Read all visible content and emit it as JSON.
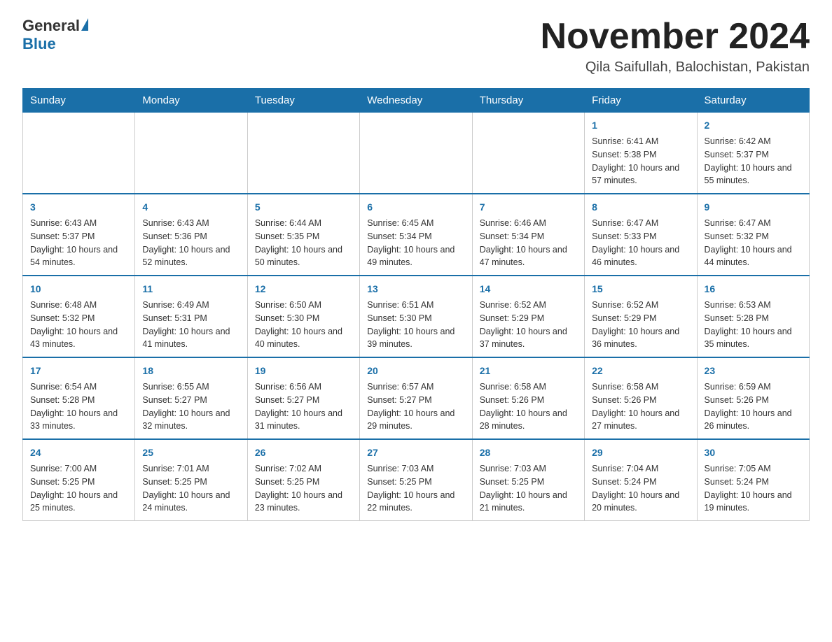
{
  "header": {
    "logo_general": "General",
    "logo_blue": "Blue",
    "month_title": "November 2024",
    "location": "Qila Saifullah, Balochistan, Pakistan"
  },
  "days_of_week": [
    "Sunday",
    "Monday",
    "Tuesday",
    "Wednesday",
    "Thursday",
    "Friday",
    "Saturday"
  ],
  "weeks": [
    [
      {
        "day": "",
        "info": ""
      },
      {
        "day": "",
        "info": ""
      },
      {
        "day": "",
        "info": ""
      },
      {
        "day": "",
        "info": ""
      },
      {
        "day": "",
        "info": ""
      },
      {
        "day": "1",
        "info": "Sunrise: 6:41 AM\nSunset: 5:38 PM\nDaylight: 10 hours and 57 minutes."
      },
      {
        "day": "2",
        "info": "Sunrise: 6:42 AM\nSunset: 5:37 PM\nDaylight: 10 hours and 55 minutes."
      }
    ],
    [
      {
        "day": "3",
        "info": "Sunrise: 6:43 AM\nSunset: 5:37 PM\nDaylight: 10 hours and 54 minutes."
      },
      {
        "day": "4",
        "info": "Sunrise: 6:43 AM\nSunset: 5:36 PM\nDaylight: 10 hours and 52 minutes."
      },
      {
        "day": "5",
        "info": "Sunrise: 6:44 AM\nSunset: 5:35 PM\nDaylight: 10 hours and 50 minutes."
      },
      {
        "day": "6",
        "info": "Sunrise: 6:45 AM\nSunset: 5:34 PM\nDaylight: 10 hours and 49 minutes."
      },
      {
        "day": "7",
        "info": "Sunrise: 6:46 AM\nSunset: 5:34 PM\nDaylight: 10 hours and 47 minutes."
      },
      {
        "day": "8",
        "info": "Sunrise: 6:47 AM\nSunset: 5:33 PM\nDaylight: 10 hours and 46 minutes."
      },
      {
        "day": "9",
        "info": "Sunrise: 6:47 AM\nSunset: 5:32 PM\nDaylight: 10 hours and 44 minutes."
      }
    ],
    [
      {
        "day": "10",
        "info": "Sunrise: 6:48 AM\nSunset: 5:32 PM\nDaylight: 10 hours and 43 minutes."
      },
      {
        "day": "11",
        "info": "Sunrise: 6:49 AM\nSunset: 5:31 PM\nDaylight: 10 hours and 41 minutes."
      },
      {
        "day": "12",
        "info": "Sunrise: 6:50 AM\nSunset: 5:30 PM\nDaylight: 10 hours and 40 minutes."
      },
      {
        "day": "13",
        "info": "Sunrise: 6:51 AM\nSunset: 5:30 PM\nDaylight: 10 hours and 39 minutes."
      },
      {
        "day": "14",
        "info": "Sunrise: 6:52 AM\nSunset: 5:29 PM\nDaylight: 10 hours and 37 minutes."
      },
      {
        "day": "15",
        "info": "Sunrise: 6:52 AM\nSunset: 5:29 PM\nDaylight: 10 hours and 36 minutes."
      },
      {
        "day": "16",
        "info": "Sunrise: 6:53 AM\nSunset: 5:28 PM\nDaylight: 10 hours and 35 minutes."
      }
    ],
    [
      {
        "day": "17",
        "info": "Sunrise: 6:54 AM\nSunset: 5:28 PM\nDaylight: 10 hours and 33 minutes."
      },
      {
        "day": "18",
        "info": "Sunrise: 6:55 AM\nSunset: 5:27 PM\nDaylight: 10 hours and 32 minutes."
      },
      {
        "day": "19",
        "info": "Sunrise: 6:56 AM\nSunset: 5:27 PM\nDaylight: 10 hours and 31 minutes."
      },
      {
        "day": "20",
        "info": "Sunrise: 6:57 AM\nSunset: 5:27 PM\nDaylight: 10 hours and 29 minutes."
      },
      {
        "day": "21",
        "info": "Sunrise: 6:58 AM\nSunset: 5:26 PM\nDaylight: 10 hours and 28 minutes."
      },
      {
        "day": "22",
        "info": "Sunrise: 6:58 AM\nSunset: 5:26 PM\nDaylight: 10 hours and 27 minutes."
      },
      {
        "day": "23",
        "info": "Sunrise: 6:59 AM\nSunset: 5:26 PM\nDaylight: 10 hours and 26 minutes."
      }
    ],
    [
      {
        "day": "24",
        "info": "Sunrise: 7:00 AM\nSunset: 5:25 PM\nDaylight: 10 hours and 25 minutes."
      },
      {
        "day": "25",
        "info": "Sunrise: 7:01 AM\nSunset: 5:25 PM\nDaylight: 10 hours and 24 minutes."
      },
      {
        "day": "26",
        "info": "Sunrise: 7:02 AM\nSunset: 5:25 PM\nDaylight: 10 hours and 23 minutes."
      },
      {
        "day": "27",
        "info": "Sunrise: 7:03 AM\nSunset: 5:25 PM\nDaylight: 10 hours and 22 minutes."
      },
      {
        "day": "28",
        "info": "Sunrise: 7:03 AM\nSunset: 5:25 PM\nDaylight: 10 hours and 21 minutes."
      },
      {
        "day": "29",
        "info": "Sunrise: 7:04 AM\nSunset: 5:24 PM\nDaylight: 10 hours and 20 minutes."
      },
      {
        "day": "30",
        "info": "Sunrise: 7:05 AM\nSunset: 5:24 PM\nDaylight: 10 hours and 19 minutes."
      }
    ]
  ]
}
